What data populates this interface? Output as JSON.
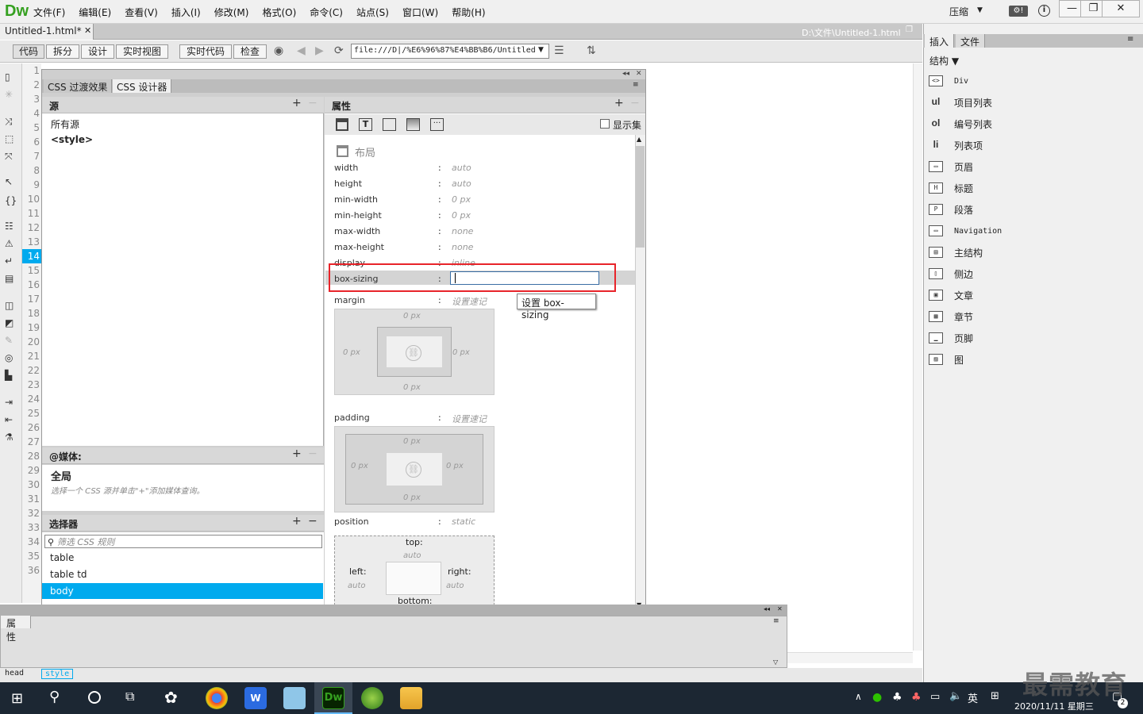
{
  "app": {
    "logo": "Dw",
    "menus": [
      "文件(F)",
      "编辑(E)",
      "查看(V)",
      "插入(I)",
      "修改(M)",
      "格式(O)",
      "命令(C)",
      "站点(S)",
      "窗口(W)",
      "帮助(H)"
    ],
    "layout_label": "压缩",
    "window_controls": {
      "minimize": "—",
      "restore": "❐",
      "close": "✕"
    }
  },
  "document": {
    "tab_label": "Untitled-1.html*",
    "path": "D:\\文件\\Untitled-1.html"
  },
  "toolbar": {
    "code": "代码",
    "split": "拆分",
    "design": "设计",
    "live_view": "实时视图",
    "live_code": "实时代码",
    "inspect": "检查",
    "url": "file:///D|/%E6%96%87%E4%BB%B6/Untitled"
  },
  "gutter": {
    "lines": [
      "1",
      "2",
      "3",
      "4",
      "5",
      "6",
      "7",
      "8",
      "9",
      "10",
      "11",
      "12",
      "13",
      "14",
      "15",
      "16",
      "17",
      "18",
      "19",
      "20",
      "21",
      "22",
      "23",
      "24",
      "25",
      "26",
      "27",
      "28",
      "29",
      "30",
      "31",
      "32",
      "33",
      "34",
      "35",
      "36"
    ],
    "highlighted": "14"
  },
  "css_panel": {
    "tabs": [
      "CSS 过渡效果",
      "CSS 设计器"
    ],
    "sources": {
      "title": "源",
      "items": [
        "所有源",
        "<style>"
      ]
    },
    "media": {
      "title": "@媒体:",
      "global": "全局",
      "hint": "选择一个 CSS 源并单击\"+\"添加媒体查询。"
    },
    "selectors": {
      "title": "选择器",
      "filter_placeholder": "筛选 CSS 规则",
      "items": [
        "table",
        "table td",
        "body"
      ],
      "selected": "body"
    },
    "properties": {
      "title": "属性",
      "show_set": "显示集",
      "section": "布局",
      "rows": [
        {
          "name": "width",
          "value": "auto"
        },
        {
          "name": "height",
          "value": "auto"
        },
        {
          "name": "min-width",
          "value": "0 px"
        },
        {
          "name": "min-height",
          "value": "0 px"
        },
        {
          "name": "max-width",
          "value": "none"
        },
        {
          "name": "max-height",
          "value": "none"
        },
        {
          "name": "display",
          "value": "inline"
        },
        {
          "name": "box-sizing",
          "value": ""
        }
      ],
      "colon": ":",
      "tooltip": "设置 box-sizing",
      "margin": {
        "label": "margin",
        "shorthand": "设置速记",
        "top": "0 px",
        "right": "0 px",
        "bottom": "0 px",
        "left": "0 px"
      },
      "padding": {
        "label": "padding",
        "shorthand": "设置速记",
        "top": "0 px",
        "right": "0 px",
        "bottom": "0 px",
        "left": "0 px"
      },
      "position": {
        "label": "position",
        "value": "static",
        "top_label": "top:",
        "top": "auto",
        "left_label": "left:",
        "left": "auto",
        "right_label": "right:",
        "right": "auto",
        "bottom_label": "bottom:"
      }
    }
  },
  "right_panel": {
    "tabs": [
      "插入",
      "文件"
    ],
    "category": "结构",
    "items": [
      {
        "icon": "<>",
        "label": "Div",
        "mono": true
      },
      {
        "icon": "ul",
        "label": "项目列表",
        "text": true
      },
      {
        "icon": "ol",
        "label": "编号列表",
        "text": true
      },
      {
        "icon": "li",
        "label": "列表项",
        "text": true
      },
      {
        "icon": "▭",
        "label": "页眉"
      },
      {
        "icon": "H",
        "label": "标题"
      },
      {
        "icon": "P",
        "label": "段落"
      },
      {
        "icon": "▭",
        "label": "Navigation",
        "mono": true
      },
      {
        "icon": "▤",
        "label": "主结构"
      },
      {
        "icon": "▯",
        "label": "侧边"
      },
      {
        "icon": "▣",
        "label": "文章"
      },
      {
        "icon": "▦",
        "label": "章节"
      },
      {
        "icon": "▁",
        "label": "页脚"
      },
      {
        "icon": "▨",
        "label": "图"
      }
    ]
  },
  "bottom": {
    "props_title": "属性",
    "tags": [
      "head",
      "style"
    ]
  },
  "taskbar": {
    "ime": "英",
    "date": "2020/11/11 星期三",
    "notif_count": "2"
  },
  "watermark": "最需教育",
  "colors": {
    "accent": "#00aaee",
    "highlight_box": "#e8242a",
    "dw_green": "#35a020"
  }
}
